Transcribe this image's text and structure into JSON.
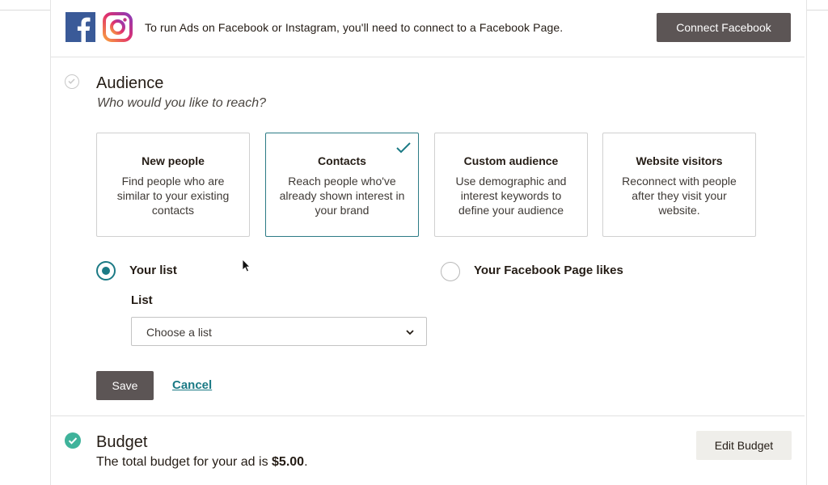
{
  "facebook": {
    "notice": "To run Ads on Facebook or Instagram, you'll need to connect to a Facebook Page.",
    "connect_label": "Connect Facebook",
    "fb_icon": "facebook-icon",
    "ig_icon": "instagram-icon"
  },
  "audience": {
    "title": "Audience",
    "subtitle": "Who would you like to reach?",
    "cards": [
      {
        "title": "New people",
        "desc": "Find people who are similar to your existing contacts",
        "selected": false
      },
      {
        "title": "Contacts",
        "desc": "Reach people who've already shown interest in your brand",
        "selected": true
      },
      {
        "title": "Custom audience",
        "desc": "Use demographic and interest keywords to define your audience",
        "selected": false
      },
      {
        "title": "Website visitors",
        "desc": "Reconnect with people after they visit your website.",
        "selected": false
      }
    ],
    "options": [
      {
        "label": "Your list",
        "selected": true
      },
      {
        "label": "Your Facebook Page likes",
        "selected": false
      }
    ],
    "list_label": "List",
    "list_placeholder": "Choose a list",
    "save_label": "Save",
    "cancel_label": "Cancel"
  },
  "budget": {
    "title": "Budget",
    "text_prefix": "The total budget for your ad is ",
    "amount": "$5.00",
    "text_suffix": ".",
    "edit_label": "Edit Budget"
  },
  "colors": {
    "accent": "#1b7a85",
    "dark_button": "#5c5555",
    "success": "#3fb39b"
  }
}
